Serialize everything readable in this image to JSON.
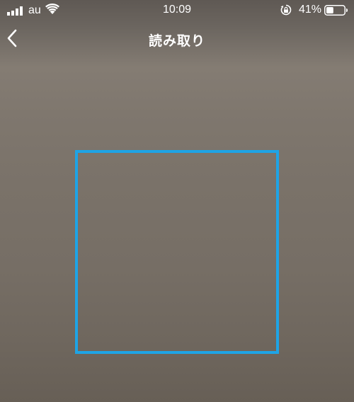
{
  "status_bar": {
    "carrier": "au",
    "time": "10:09",
    "battery_percent": "41%",
    "battery_level": 0.41,
    "icons": [
      "signal-icon",
      "wifi-icon",
      "rotation-lock-icon",
      "battery-icon"
    ]
  },
  "nav": {
    "title": "読み取り",
    "back_icon": "chevron-left-icon"
  },
  "scanner": {
    "frame_color": "#1ea4e6"
  },
  "colors": {
    "accent": "#1ea4e6",
    "text": "#ffffff"
  }
}
